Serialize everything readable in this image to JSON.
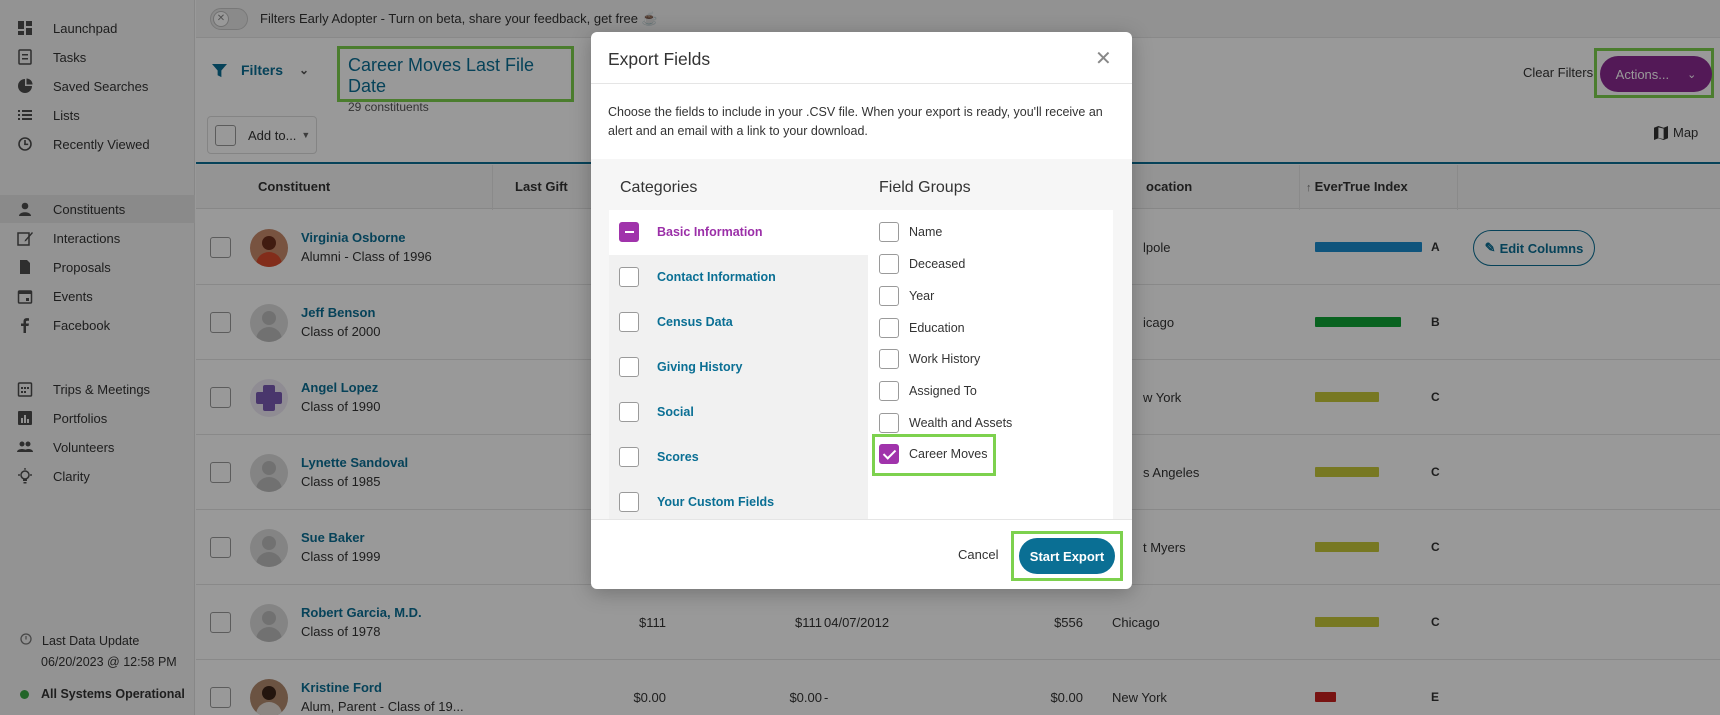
{
  "sidebar": {
    "items": [
      {
        "label": "Launchpad",
        "icon": "dashboard-icon"
      },
      {
        "label": "Tasks",
        "icon": "tasks-icon"
      },
      {
        "label": "Saved Searches",
        "icon": "pie-chart-icon"
      },
      {
        "label": "Lists",
        "icon": "list-icon"
      },
      {
        "label": "Recently Viewed",
        "icon": "history-icon"
      },
      {
        "label": "Constituents",
        "icon": "person-icon"
      },
      {
        "label": "Interactions",
        "icon": "edit-icon"
      },
      {
        "label": "Proposals",
        "icon": "document-icon"
      },
      {
        "label": "Events",
        "icon": "calendar-icon"
      },
      {
        "label": "Facebook",
        "icon": "facebook-icon"
      },
      {
        "label": "Trips & Meetings",
        "icon": "calendar-grid-icon"
      },
      {
        "label": "Portfolios",
        "icon": "bar-chart-icon"
      },
      {
        "label": "Volunteers",
        "icon": "people-icon"
      },
      {
        "label": "Clarity",
        "icon": "lightbulb-icon"
      }
    ],
    "last_update_label": "Last Data Update",
    "last_update_value": "06/20/2023 @ 12:58 PM",
    "status": "All Systems Operational"
  },
  "banner": {
    "text": "Filters Early Adopter - Turn on beta, share your feedback, get free ☕"
  },
  "header": {
    "filters_label": "Filters",
    "search_title": "Career Moves Last File Date",
    "search_count": "29 constituents",
    "clear_filters": "Clear Filters",
    "actions_label": "Actions..."
  },
  "toolbar": {
    "add_to": "Add to...",
    "map": "Map"
  },
  "table": {
    "headers": {
      "constituent": "Constituent",
      "last_gift": "Last Gift",
      "location": "ocation",
      "evertrue_index": "EverTrue Index"
    },
    "edit_columns": "Edit Columns",
    "rows": [
      {
        "name": "Virginia Osborne",
        "sub": "Alumni - Class of 1996",
        "location": "lpole",
        "grade": "A",
        "bar_color": "#1a8ccf",
        "bar_fraction": 1.0
      },
      {
        "name": "Jeff Benson",
        "sub": "Class of 2000",
        "location": "icago",
        "grade": "B",
        "bar_color": "#0fa336",
        "bar_fraction": 0.8
      },
      {
        "name": "Angel Lopez",
        "sub": "Class of 1990",
        "location": "w York",
        "grade": "C",
        "bar_color": "#c6c83a",
        "bar_fraction": 0.6
      },
      {
        "name": "Lynette Sandoval",
        "sub": "Class of 1985",
        "location": "s Angeles",
        "grade": "C",
        "bar_color": "#c6c83a",
        "bar_fraction": 0.6
      },
      {
        "name": "Sue Baker",
        "sub": "Class of 1999",
        "location": "t Myers",
        "grade": "C",
        "bar_color": "#c6c83a",
        "bar_fraction": 0.6
      },
      {
        "name": "Robert Garcia, M.D.",
        "sub": "Class of 1978",
        "last_gift": "$111",
        "col2": "$111",
        "date": "04/07/2012",
        "col4": "$556",
        "location": "Chicago",
        "grade": "C",
        "bar_color": "#c6c83a",
        "bar_fraction": 0.6
      },
      {
        "name": "Kristine Ford",
        "sub": "Alum, Parent - Class of 19...",
        "last_gift": "$0.00",
        "col2": "$0.00",
        "date": "-",
        "col4": "$0.00",
        "location": "New York",
        "grade": "E",
        "bar_color": "#c9201e",
        "bar_fraction": 0.2
      }
    ]
  },
  "modal": {
    "title": "Export Fields",
    "description": "Choose the fields to include in your .CSV file. When your export is ready, you'll receive an alert and an email with a link to your download.",
    "categories_header": "Categories",
    "field_groups_header": "Field Groups",
    "categories": [
      "Basic Information",
      "Contact Information",
      "Census Data",
      "Giving History",
      "Social",
      "Scores",
      "Your Custom Fields"
    ],
    "field_groups": [
      "Name",
      "Deceased",
      "Year",
      "Education",
      "Work History",
      "Assigned To",
      "Wealth and Assets",
      "Career Moves"
    ],
    "cancel": "Cancel",
    "start_export": "Start Export"
  }
}
